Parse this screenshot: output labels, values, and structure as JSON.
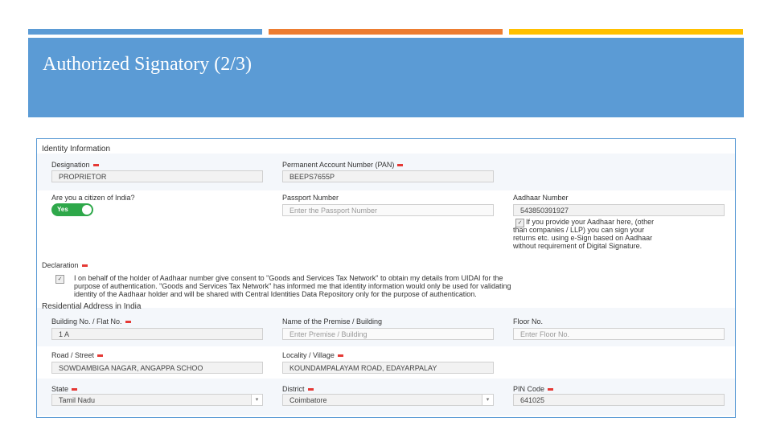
{
  "slide": {
    "title": "Authorized Signatory (2/3)"
  },
  "form": {
    "identity_section": "Identity Information",
    "designation": {
      "label": "Designation",
      "value": "PROPRIETOR"
    },
    "pan": {
      "label": "Permanent Account Number (PAN)",
      "value": "BEEPS7655P"
    },
    "citizen": {
      "label": "Are you a citizen of India?",
      "toggle": "Yes"
    },
    "passport": {
      "label": "Passport Number",
      "placeholder": "Enter the Passport Number"
    },
    "aadhaar": {
      "label": "Aadhaar Number",
      "value": "543850391927",
      "note_1": "If you provide your Aadhaar here, (other",
      "note_2": "than companies / LLP) you can sign your",
      "note_3": "returns etc. using e-Sign based on Aadhaar",
      "note_4": "without requirement of Digital Signature."
    },
    "declaration": {
      "label": "Declaration",
      "line_1": "I on behalf of the holder of Aadhaar number give consent to \"Goods and Services Tax Network\" to obtain my details from UIDAI for the",
      "line_2": "purpose of authentication. \"Goods and Services Tax Network\" has informed me that identity information would only be used for validating",
      "line_3": "identity of the Aadhaar holder and will be shared with Central Identities Data Repository only for the purpose of authentication."
    },
    "address_section": "Residential Address in India",
    "building": {
      "label": "Building No. / Flat No.",
      "value": "1 A"
    },
    "premise": {
      "label": "Name of the Premise / Building",
      "placeholder": "Enter Premise / Building"
    },
    "floor": {
      "label": "Floor No.",
      "placeholder": "Enter Floor No."
    },
    "road": {
      "label": "Road / Street",
      "value": "SOWDAMBIGA NAGAR, ANGAPPA SCHOO"
    },
    "locality": {
      "label": "Locality / Village",
      "value": "KOUNDAMPALAYAM ROAD, EDAYARPALAY"
    },
    "state": {
      "label": "State",
      "value": "Tamil Nadu"
    },
    "district": {
      "label": "District",
      "value": "Coimbatore"
    },
    "pin": {
      "label": "PIN Code",
      "value": "641025"
    }
  },
  "colors": {
    "accent_blue": "#5b9bd5",
    "accent_orange": "#ed7d31",
    "accent_gold": "#ffc000",
    "toggle_green": "#2ea84a",
    "required_red": "#e53935"
  }
}
